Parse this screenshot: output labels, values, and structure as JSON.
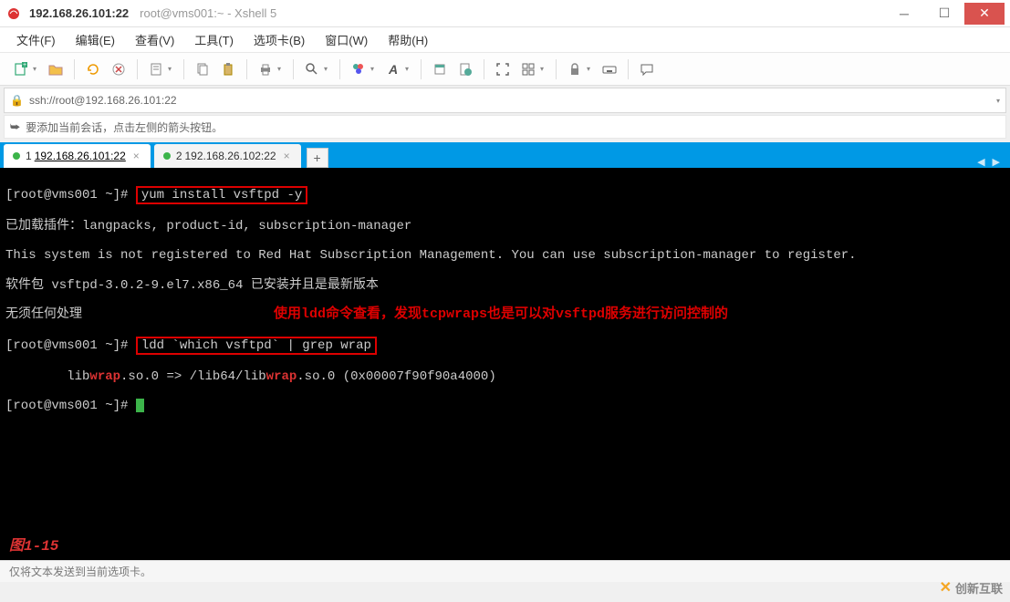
{
  "title": {
    "ip": "192.168.26.101:22",
    "sub": "root@vms001:~ - Xshell 5"
  },
  "menu": {
    "file": "文件(F)",
    "edit": "编辑(E)",
    "view": "查看(V)",
    "tools": "工具(T)",
    "tabs": "选项卡(B)",
    "window": "窗口(W)",
    "help": "帮助(H)"
  },
  "address": {
    "url": "ssh://root@192.168.26.101:22"
  },
  "tip": {
    "text": "要添加当前会话，点击左侧的箭头按钮。"
  },
  "tabs": [
    {
      "num": "1",
      "label": "192.168.26.101:22",
      "active": true
    },
    {
      "num": "2",
      "label": "192.168.26.102:22",
      "active": false
    }
  ],
  "terminal": {
    "prompt1_pre": "[root@vms001 ~]# ",
    "cmd1": "yum install vsftpd -y",
    "line2": "已加载插件：langpacks, product-id, subscription-manager",
    "line3": "This system is not registered to Red Hat Subscription Management. You can use subscription-manager to register.",
    "line4": "软件包 vsftpd-3.0.2-9.el7.x86_64 已安装并且是最新版本",
    "line5": "无须任何处理",
    "prompt2_pre": "[root@vms001 ~]# ",
    "cmd2": "ldd `which vsftpd` | grep wrap",
    "line7_a": "        lib",
    "line7_b": "wrap",
    "line7_c": ".so.0 => /lib64/lib",
    "line7_d": "wrap",
    "line7_e": ".so.0 (0x00007f90f90a4000)",
    "prompt3": "[root@vms001 ~]# ",
    "note": "使用ldd命令查看，发现tcpwraps也是可以对vsftpd服务进行访问控制的",
    "figure_label": "图1-15"
  },
  "status": {
    "text": "仅将文本发送到当前选项卡。"
  },
  "watermark": {
    "text": "创新互联"
  }
}
